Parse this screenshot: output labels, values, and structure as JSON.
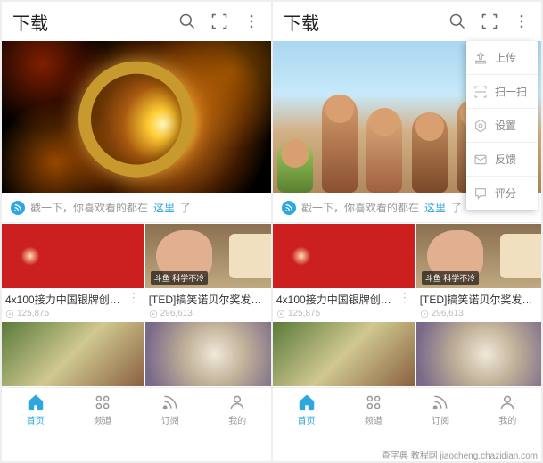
{
  "header": {
    "title": "下载"
  },
  "pull_hint": {
    "pre": "戳一下，你喜欢看的都在",
    "link": "这里",
    "post": "了"
  },
  "cards": [
    {
      "title": "4x100接力中国银牌创…",
      "plays": "125,875",
      "badge": ""
    },
    {
      "title": "[TED]搞笑诺贝尔奖发…",
      "plays": "296,613",
      "badge": "斗鱼 科学不冷"
    }
  ],
  "nav": {
    "home": "首页",
    "channel": "频道",
    "subscribe": "订阅",
    "mine": "我的"
  },
  "menu": {
    "upload": "上传",
    "scan": "扫一扫",
    "settings": "设置",
    "feedback": "反馈",
    "rate": "评分"
  },
  "watermark": "查字典 教程网  jiaocheng.chazidian.com"
}
